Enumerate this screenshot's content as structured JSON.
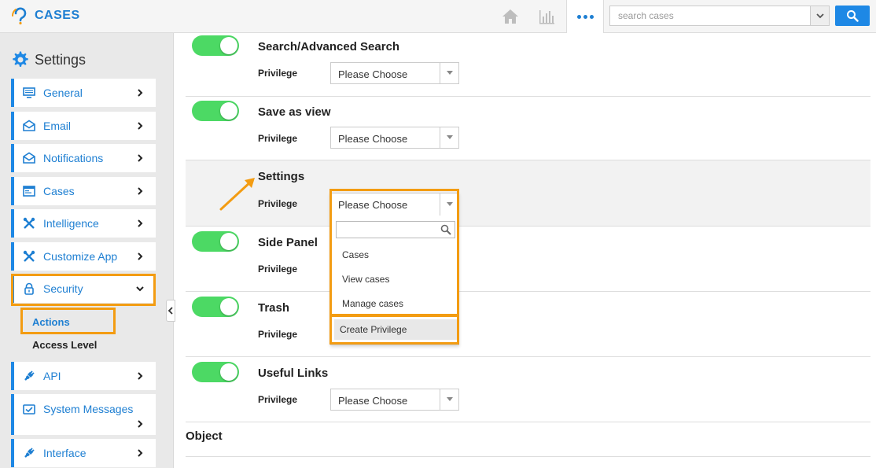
{
  "app": {
    "name": "CASES"
  },
  "header": {
    "search_placeholder": "search cases",
    "icons": [
      "home-icon",
      "chart-icon",
      "more-icon",
      "search-icon"
    ]
  },
  "sidebar": {
    "title": "Settings",
    "items": [
      {
        "label": "General",
        "icon": "monitor-icon"
      },
      {
        "label": "Email",
        "icon": "envelope-icon"
      },
      {
        "label": "Notifications",
        "icon": "envelope-icon"
      },
      {
        "label": "Cases",
        "icon": "window-icon"
      },
      {
        "label": "Intelligence",
        "icon": "tools-icon"
      },
      {
        "label": "Customize App",
        "icon": "tools-icon"
      },
      {
        "label": "Security",
        "icon": "lock-icon"
      },
      {
        "label": "API",
        "icon": "plug-icon"
      },
      {
        "label": "System Messages",
        "icon": "message-icon"
      },
      {
        "label": "Interface",
        "icon": "plug-icon"
      }
    ],
    "security_sub": [
      {
        "label": "Actions",
        "active": true
      },
      {
        "label": "Access Level",
        "active": false
      }
    ]
  },
  "main": {
    "rows": [
      {
        "title": "Search/Advanced Search",
        "privilege_label": "Privilege",
        "select_value": "Please Choose",
        "toggle_on": true
      },
      {
        "title": "Save as view",
        "privilege_label": "Privilege",
        "select_value": "Please Choose",
        "toggle_on": true
      },
      {
        "title": "Settings",
        "privilege_label": "Privilege",
        "select_value": "Please Choose",
        "toggle_on": false
      },
      {
        "title": "Side Panel",
        "privilege_label": "Privilege",
        "select_value": "",
        "toggle_on": true
      },
      {
        "title": "Trash",
        "privilege_label": "Privilege",
        "select_value": "",
        "toggle_on": true
      },
      {
        "title": "Useful Links",
        "privilege_label": "Privilege",
        "select_value": "Please Choose",
        "toggle_on": true
      }
    ],
    "object_title": "Object"
  },
  "dropdown": {
    "selected": "Please Choose",
    "options": [
      "Cases",
      "View cases",
      "Manage cases"
    ],
    "create_label": "Create Privilege"
  },
  "colors": {
    "brand": "#1e7fd2",
    "accent_highlight": "#f39c12",
    "toggle_on": "#4cd964"
  }
}
